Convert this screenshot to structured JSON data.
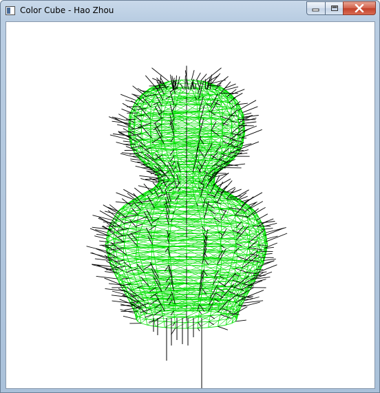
{
  "window": {
    "title": "Color Cube - Hao Zhou",
    "controls": {
      "minimize_icon": "minimize-icon",
      "maximize_icon": "maximize-icon",
      "close_icon": "close-icon"
    }
  },
  "scene": {
    "description_icon": "wireframe-mesh",
    "mesh_color": "#00e000",
    "normal_color": "#000000",
    "background_color": "#ffffff"
  }
}
